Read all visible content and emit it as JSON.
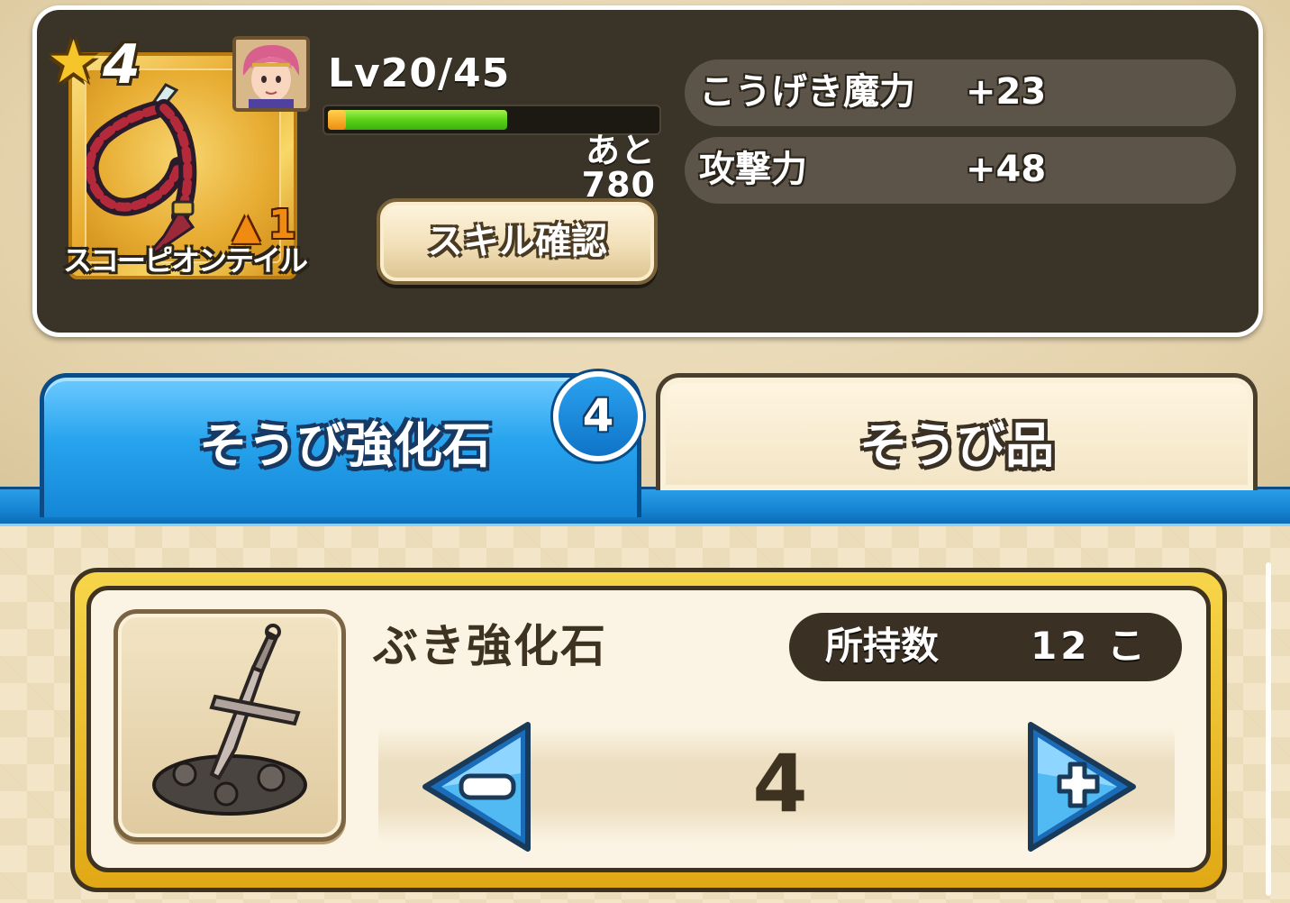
{
  "item": {
    "rarity": "4",
    "upgrade_level": "1",
    "name": "スコーピオンテイル"
  },
  "level": {
    "text": "Lv20/45",
    "remaining_exp": "あと 780",
    "exp_progress": 0.54
  },
  "skill_button_label": "スキル確認",
  "stats": [
    {
      "label": "こうげき魔力",
      "value": "+23"
    },
    {
      "label": "攻撃力",
      "value": "+48"
    }
  ],
  "tabs": {
    "active": {
      "label": "そうび強化石",
      "badge": "4"
    },
    "inactive": {
      "label": "そうび品"
    }
  },
  "material": {
    "name": "ぶき強化石",
    "owned_label": "所持数",
    "owned_count": "12 こ",
    "quantity": "4"
  },
  "colors": {
    "panel_dark": "#3a3428",
    "tab_blue": "#1c92e0",
    "exp_green": "#5ad21a",
    "card_gold": "#f0c838"
  },
  "icons": {
    "rarity": "star-icon",
    "upgrade": "up-arrow-icon",
    "weapon": "whip-icon",
    "material": "sword-stone-icon",
    "decrease": "minus-arrow-icon",
    "increase": "plus-arrow-icon"
  }
}
